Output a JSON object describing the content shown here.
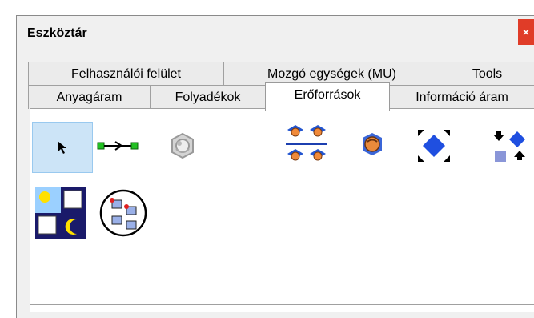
{
  "window": {
    "title": "Eszköztár",
    "close_glyph": "×"
  },
  "tabs": {
    "row1": [
      "Felhasználói felület",
      "Mozgó egységek (MU)",
      "Tools"
    ],
    "row2": [
      "Anyagáram",
      "Folyadékok",
      "Erőforrások",
      "Információ áram"
    ],
    "active": "Erőforrások"
  },
  "tools": [
    {
      "icon": "pointer-arrow-icon",
      "selected": true
    },
    {
      "icon": "connector-icon",
      "selected": false
    },
    {
      "icon": "gear-worker-icon",
      "selected": false
    },
    {
      "icon": "workers-group-icon",
      "selected": false
    },
    {
      "icon": "worker-icon",
      "selected": false
    },
    {
      "icon": "expand-diamond-icon",
      "selected": false
    },
    {
      "icon": "arrange-icon",
      "selected": false
    },
    {
      "icon": "shift-calendar-icon",
      "selected": false
    },
    {
      "icon": "network-circle-icon",
      "selected": false
    }
  ],
  "colors": {
    "accent": "#e03c28",
    "selection": "#cce4f7",
    "diamond": "#1f4fe0"
  }
}
